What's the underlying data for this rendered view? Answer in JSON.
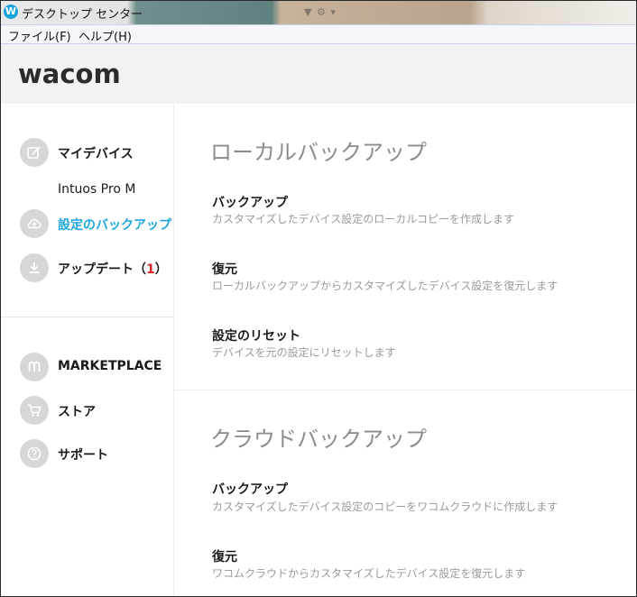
{
  "window": {
    "title": "デスクトップ センター",
    "app_icon": "W"
  },
  "menu": [
    {
      "label": "ファイル(F)"
    },
    {
      "label": "ヘルプ(H)"
    }
  ],
  "header": {
    "logo": "wacom"
  },
  "sidebar": {
    "my_devices_label": "マイデバイス",
    "device_name": "Intuos Pro M",
    "backup_label": "設定のバックアップ",
    "update_label": "アップデート",
    "update_count": "1",
    "marketplace_label": "MARKETPLACE",
    "store_label": "ストア",
    "support_label": "サポート"
  },
  "main": {
    "local": {
      "title": "ローカルバックアップ",
      "items": [
        {
          "title": "バックアップ",
          "desc": "カスタマイズしたデバイス設定のローカルコピーを作成します"
        },
        {
          "title": "復元",
          "desc": "ローカルバックアップからカスタマイズしたデバイス設定を復元します"
        },
        {
          "title": "設定のリセット",
          "desc": "デバイスを元の設定にリセットします"
        }
      ]
    },
    "cloud": {
      "title": "クラウドバックアップ",
      "items": [
        {
          "title": "バックアップ",
          "desc": "カスタマイズしたデバイス設定のコピーをワコムクラウドに作成します"
        },
        {
          "title": "復元",
          "desc": "ワコムクラウドからカスタマイズしたデバイス設定を復元します"
        }
      ]
    }
  },
  "colors": {
    "accent": "#1fa7e0",
    "badge": "#dd2222",
    "icon_circle": "#d7d7d7"
  }
}
